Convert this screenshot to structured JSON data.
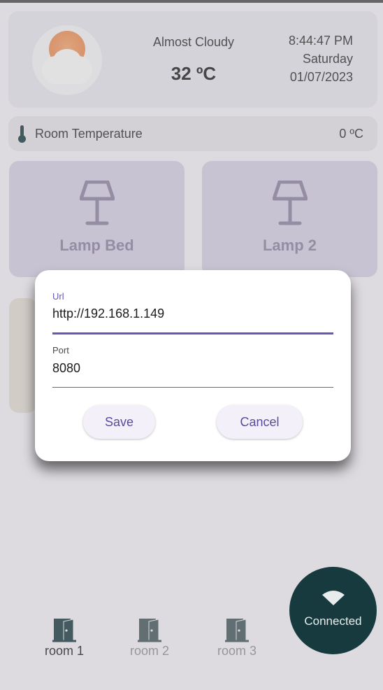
{
  "weather": {
    "condition": "Almost Cloudy",
    "temperature": "32 ºC",
    "time": "8:44:47 PM",
    "day": "Saturday",
    "date": "01/07/2023",
    "icon": "sun-cloud-icon"
  },
  "room_temperature": {
    "label": "Room Temperature",
    "value": "0 ºC",
    "icon": "thermometer-icon"
  },
  "devices": [
    {
      "label": "Lamp Bed",
      "icon": "lamp-icon"
    },
    {
      "label": "Lamp 2",
      "icon": "lamp-icon"
    }
  ],
  "dialog": {
    "url_label": "Url",
    "url_value": "http://192.168.1.149",
    "port_label": "Port",
    "port_value": "8080",
    "save_label": "Save",
    "cancel_label": "Cancel"
  },
  "nav": {
    "items": [
      {
        "label": "room 1",
        "selected": true,
        "icon": "door-icon"
      },
      {
        "label": "room 2",
        "selected": false,
        "icon": "door-icon"
      },
      {
        "label": "room 3",
        "selected": false,
        "icon": "door-icon"
      }
    ]
  },
  "connection": {
    "label": "Connected",
    "icon": "wifi-icon"
  },
  "colors": {
    "accent": "#6b55b8",
    "primary_dark": "#173a3f",
    "device_card": "#d6cfe4"
  }
}
